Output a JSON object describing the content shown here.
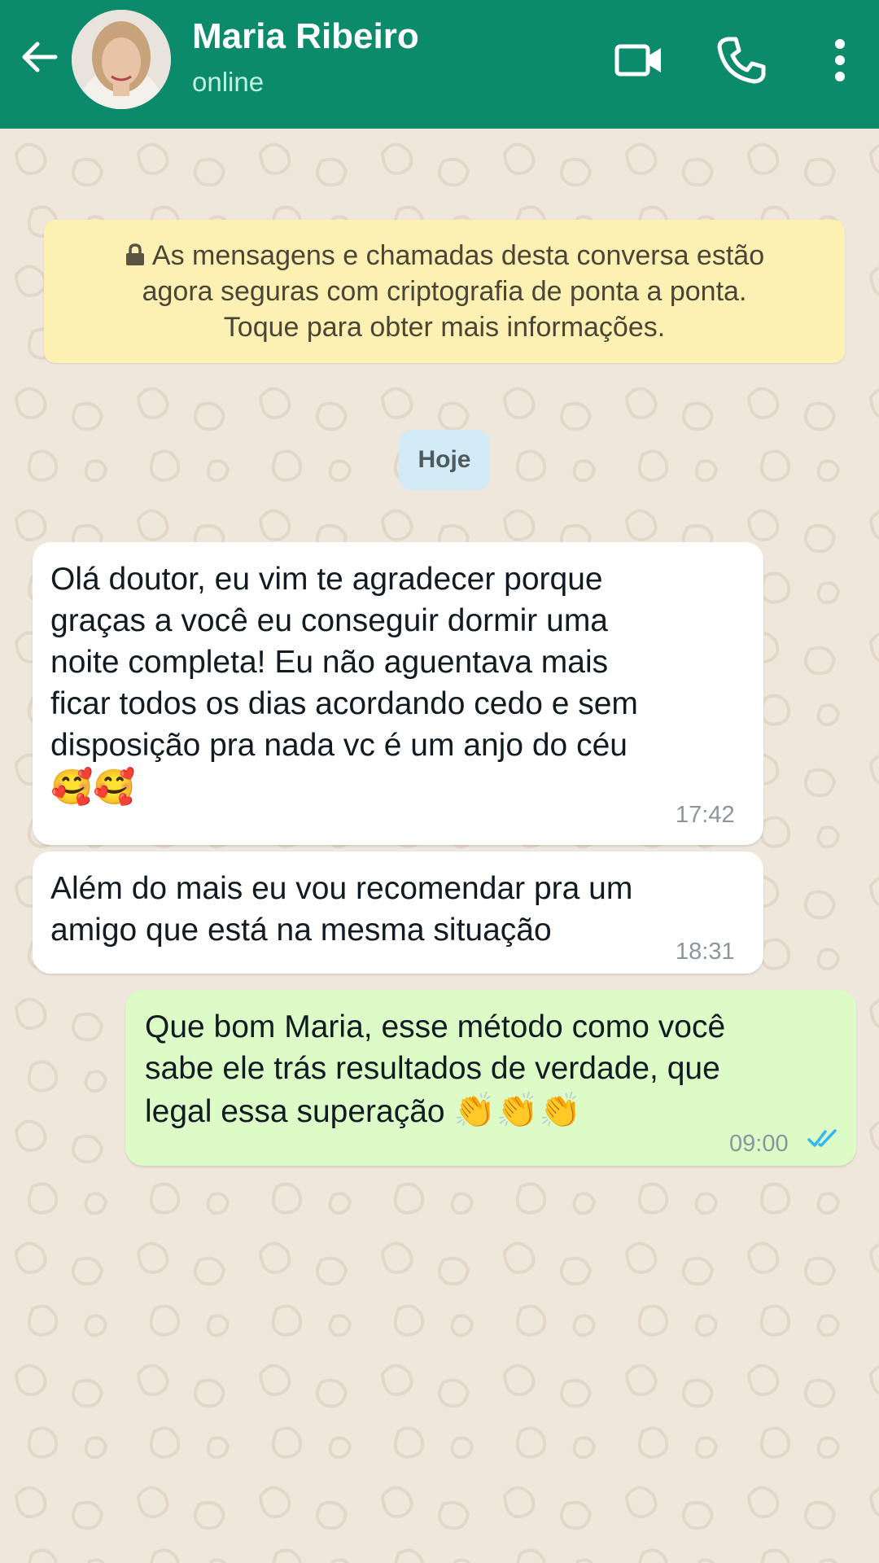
{
  "header": {
    "contact_name": "Maria Ribeiro",
    "status": "online",
    "icons": [
      "back-arrow-icon",
      "avatar",
      "video-call-icon",
      "voice-call-icon",
      "more-options-icon"
    ],
    "background_color": "#0c8a6c"
  },
  "encryption_notice": {
    "line1": "As mensagens e chamadas desta conversa estão",
    "line2": "agora seguras com criptografia de ponta a ponta.",
    "line3": "Toque para obter mais informações.",
    "icon": "lock-icon",
    "background_color": "#fcf1b3"
  },
  "date_separator": "Hoje",
  "messages": [
    {
      "direction": "incoming",
      "lines": [
        "Olá doutor, eu vim te agradecer porque",
        "graças a você eu conseguir dormir uma",
        "noite completa! Eu não aguentava mais",
        "ficar todos os dias acordando cedo e sem",
        "disposição pra nada vc é um anjo do céu"
      ],
      "emoji": "🥰🥰",
      "time": "17:42"
    },
    {
      "direction": "incoming",
      "lines": [
        "Além do mais eu vou recomendar pra um",
        "amigo que está na mesma situação"
      ],
      "time": "18:31"
    },
    {
      "direction": "outgoing",
      "lines": [
        "Que bom Maria, esse método como você",
        "sabe ele trás resultados de verdade, que",
        "legal essa superação"
      ],
      "emoji": "👏👏👏",
      "time": "09:00",
      "status_icon": "double-check-read-icon",
      "bubble_color": "#dcfbc6"
    }
  ]
}
